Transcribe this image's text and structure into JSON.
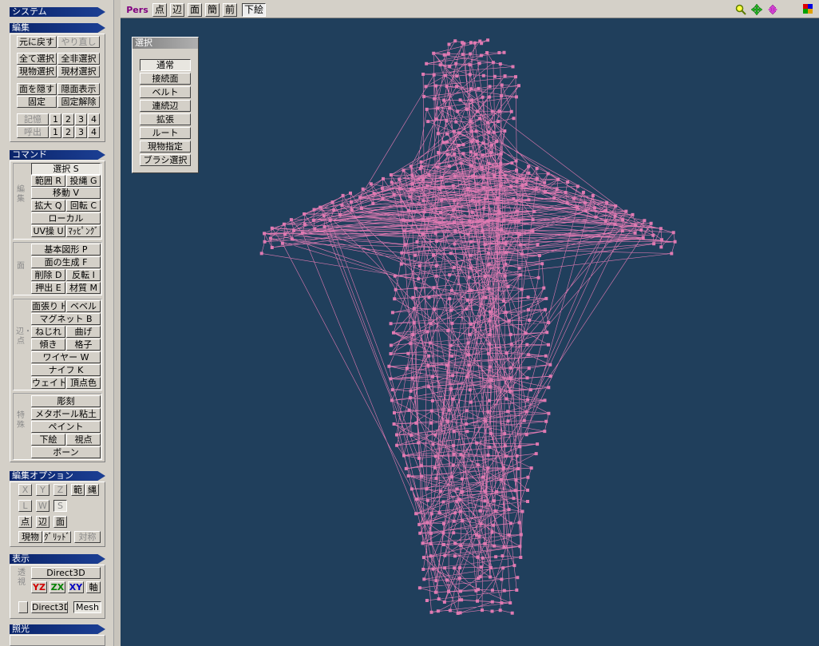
{
  "sidebar": {
    "system": "システム",
    "edit": {
      "title": "編集",
      "undo": "元に戻す",
      "redo": "やり直し",
      "select_all": "全て選択",
      "deselect_all": "全非選択",
      "select_current_obj": "現物選択",
      "select_current_mat": "現材選択",
      "hide_face": "面を隠す",
      "show_hidden": "隠面表示",
      "lock": "固定",
      "unlock": "固定解除",
      "memory_label": "記憶",
      "recall_label": "呼出",
      "slots": [
        "1",
        "2",
        "3",
        "4"
      ]
    },
    "command": {
      "title": "コマンド",
      "group_edit": "編集",
      "select": "選択 S",
      "range": "範囲 R",
      "lasso": "投縄 G",
      "move": "移動 V",
      "scale": "拡大 Q",
      "rotate": "回転 C",
      "local": "ローカル",
      "uv": "UV操 U",
      "mapping": "ﾏｯﾋﾟﾝｸﾞ",
      "group_face": "面",
      "primitive": "基本図形 P",
      "face_create": "面の生成 F",
      "delete": "削除 D",
      "flip": "反転 I",
      "extrude": "押出 E",
      "material": "材質 M",
      "group_edge": "辺・点",
      "face_fill": "面張り H",
      "bevel": "ベベル",
      "magnet": "マグネット B",
      "twist": "ねじれ",
      "bend": "曲げ",
      "tilt": "傾き",
      "lattice": "格子",
      "wire": "ワイヤー W",
      "knife": "ナイフ K",
      "weight": "ウェイト",
      "vertex_color": "頂点色",
      "group_special": "特殊",
      "sculpt": "彫刻",
      "metaball": "メタボール粘土",
      "paint": "ペイント",
      "underlay": "下絵",
      "viewpoint": "視点",
      "bone": "ボーン"
    },
    "edit_options": {
      "title": "編集オプション",
      "x": "X",
      "y": "Y",
      "z": "Z",
      "range": "範",
      "rope": "縄",
      "l": "L",
      "w": "W",
      "s": "S",
      "point": "点",
      "edge": "辺",
      "face": "面",
      "current": "現物",
      "grid": "ｸﾞﾘｯﾄﾞ",
      "symmetry": "対称"
    },
    "display": {
      "title": "表示",
      "perspective_label": "透視",
      "direct3d": "Direct3D",
      "yz": "YZ",
      "zx": "ZX",
      "xy": "XY",
      "axis": "軸",
      "direct3d_small": "Direct3D",
      "mesh": "Mesh"
    },
    "lighting": {
      "title": "照光"
    }
  },
  "toolbar": {
    "pers": "Pers",
    "point": "点",
    "edge": "辺",
    "face": "面",
    "simple": "簡",
    "front": "前",
    "underlay": "下絵"
  },
  "select_panel": {
    "title": "選択",
    "items": [
      "通常",
      "接続面",
      "ベルト",
      "連続辺",
      "拡張",
      "ルート",
      "現物指定",
      "ブラシ選択"
    ]
  },
  "colors": {
    "viewport_bg": "#203f5c",
    "mesh": "#e07ab2",
    "header": "#0a246a"
  },
  "icons": [
    "zoom-icon",
    "pan-icon",
    "rotate-view-icon",
    "color-palette-icon"
  ]
}
